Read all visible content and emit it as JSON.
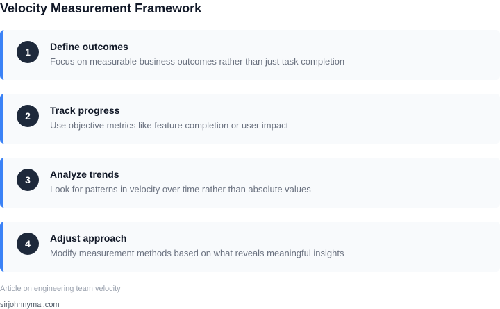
{
  "title": "Velocity Measurement Framework",
  "steps": [
    {
      "number": "1",
      "title": "Define outcomes",
      "description": "Focus on measurable business outcomes rather than just task completion"
    },
    {
      "number": "2",
      "title": "Track progress",
      "description": "Use objective metrics like feature completion or user impact"
    },
    {
      "number": "3",
      "title": "Analyze trends",
      "description": "Look for patterns in velocity over time rather than absolute values"
    },
    {
      "number": "4",
      "title": "Adjust approach",
      "description": "Modify measurement methods based on what reveals meaningful insights"
    }
  ],
  "caption": "Article on engineering team velocity",
  "source": "sirjohnnymai.com",
  "colors": {
    "accent": "#3b82f6",
    "badge": "#1e293b",
    "card": "#f8fafc"
  }
}
